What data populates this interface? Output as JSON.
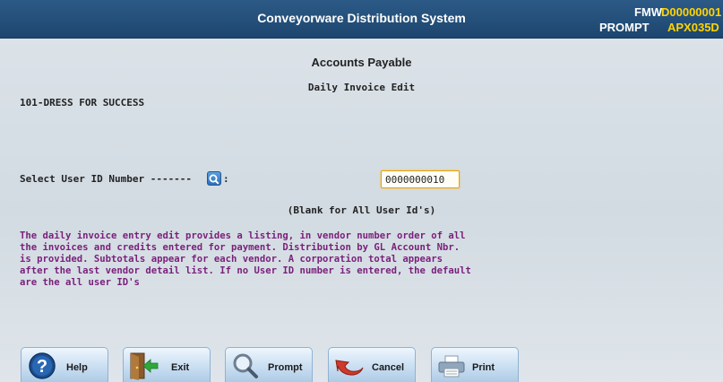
{
  "header": {
    "title": "Conveyorware Distribution System",
    "line1_label": "FMW",
    "line1_value": "D00000001",
    "line2_label": "PROMPT",
    "line2_value": "APX035D"
  },
  "screen": {
    "heading": "Accounts Payable",
    "subheading": "Daily Invoice Edit",
    "company": "101-DRESS FOR SUCCESS"
  },
  "form": {
    "user_id_label": "Select User ID Number -------",
    "colon": ":",
    "user_id_value": "0000000010",
    "hint": "(Blank for All User Id's)"
  },
  "description": {
    "lines": [
      "The daily invoice entry edit provides a listing, in vendor number order of all",
      "the invoices and credits entered for payment. Distribution by GL Account Nbr.",
      "is provided. Subtotals appear for each vendor. A corporation total appears",
      "after the last vendor detail list. If no User ID number is entered, the default",
      "are the all user ID's"
    ]
  },
  "footer": {
    "help_label": "Help",
    "exit_label": "Exit",
    "prompt_label": "Prompt",
    "cancel_label": "Cancel",
    "print_label": "Print"
  },
  "colors": {
    "titlebar": "#1f4a74",
    "code_value": "#ffd400",
    "description_text": "#7a1f7a",
    "input_border": "#f0a000"
  },
  "icons": {
    "help": "help-icon",
    "exit": "exit-door-icon",
    "prompt": "magnifier-icon",
    "cancel": "undo-arrow-icon",
    "print": "printer-icon",
    "lookup": "search-icon"
  }
}
